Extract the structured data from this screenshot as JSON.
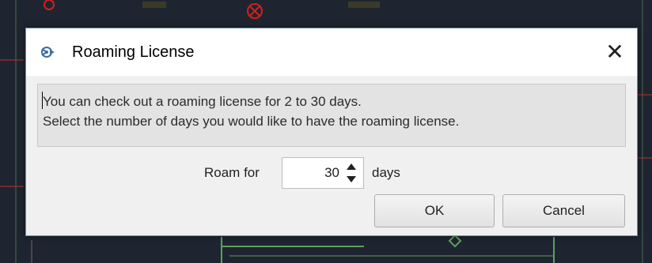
{
  "dialog": {
    "title": "Roaming License",
    "close_glyph": "✕",
    "message_line1": "You can check out a roaming license for 2 to 30 days.",
    "message_line2": "Select the number of days you would like to have the roaming license.",
    "roam_for_label": "Roam for",
    "days_value": "30",
    "days_label": "days",
    "ok_label": "OK",
    "cancel_label": "Cancel"
  },
  "icons": {
    "app": "roaming-app-icon",
    "close": "close-icon",
    "spin_up": "chevron-up-icon",
    "spin_down": "chevron-down-icon"
  },
  "colors": {
    "backdrop": "#1e2530",
    "dialog_bg": "#f0f0f0",
    "message_bg": "#e3e3e3",
    "border_accent": "#6b8fb8",
    "icon_accent": "#3b6ea5"
  }
}
